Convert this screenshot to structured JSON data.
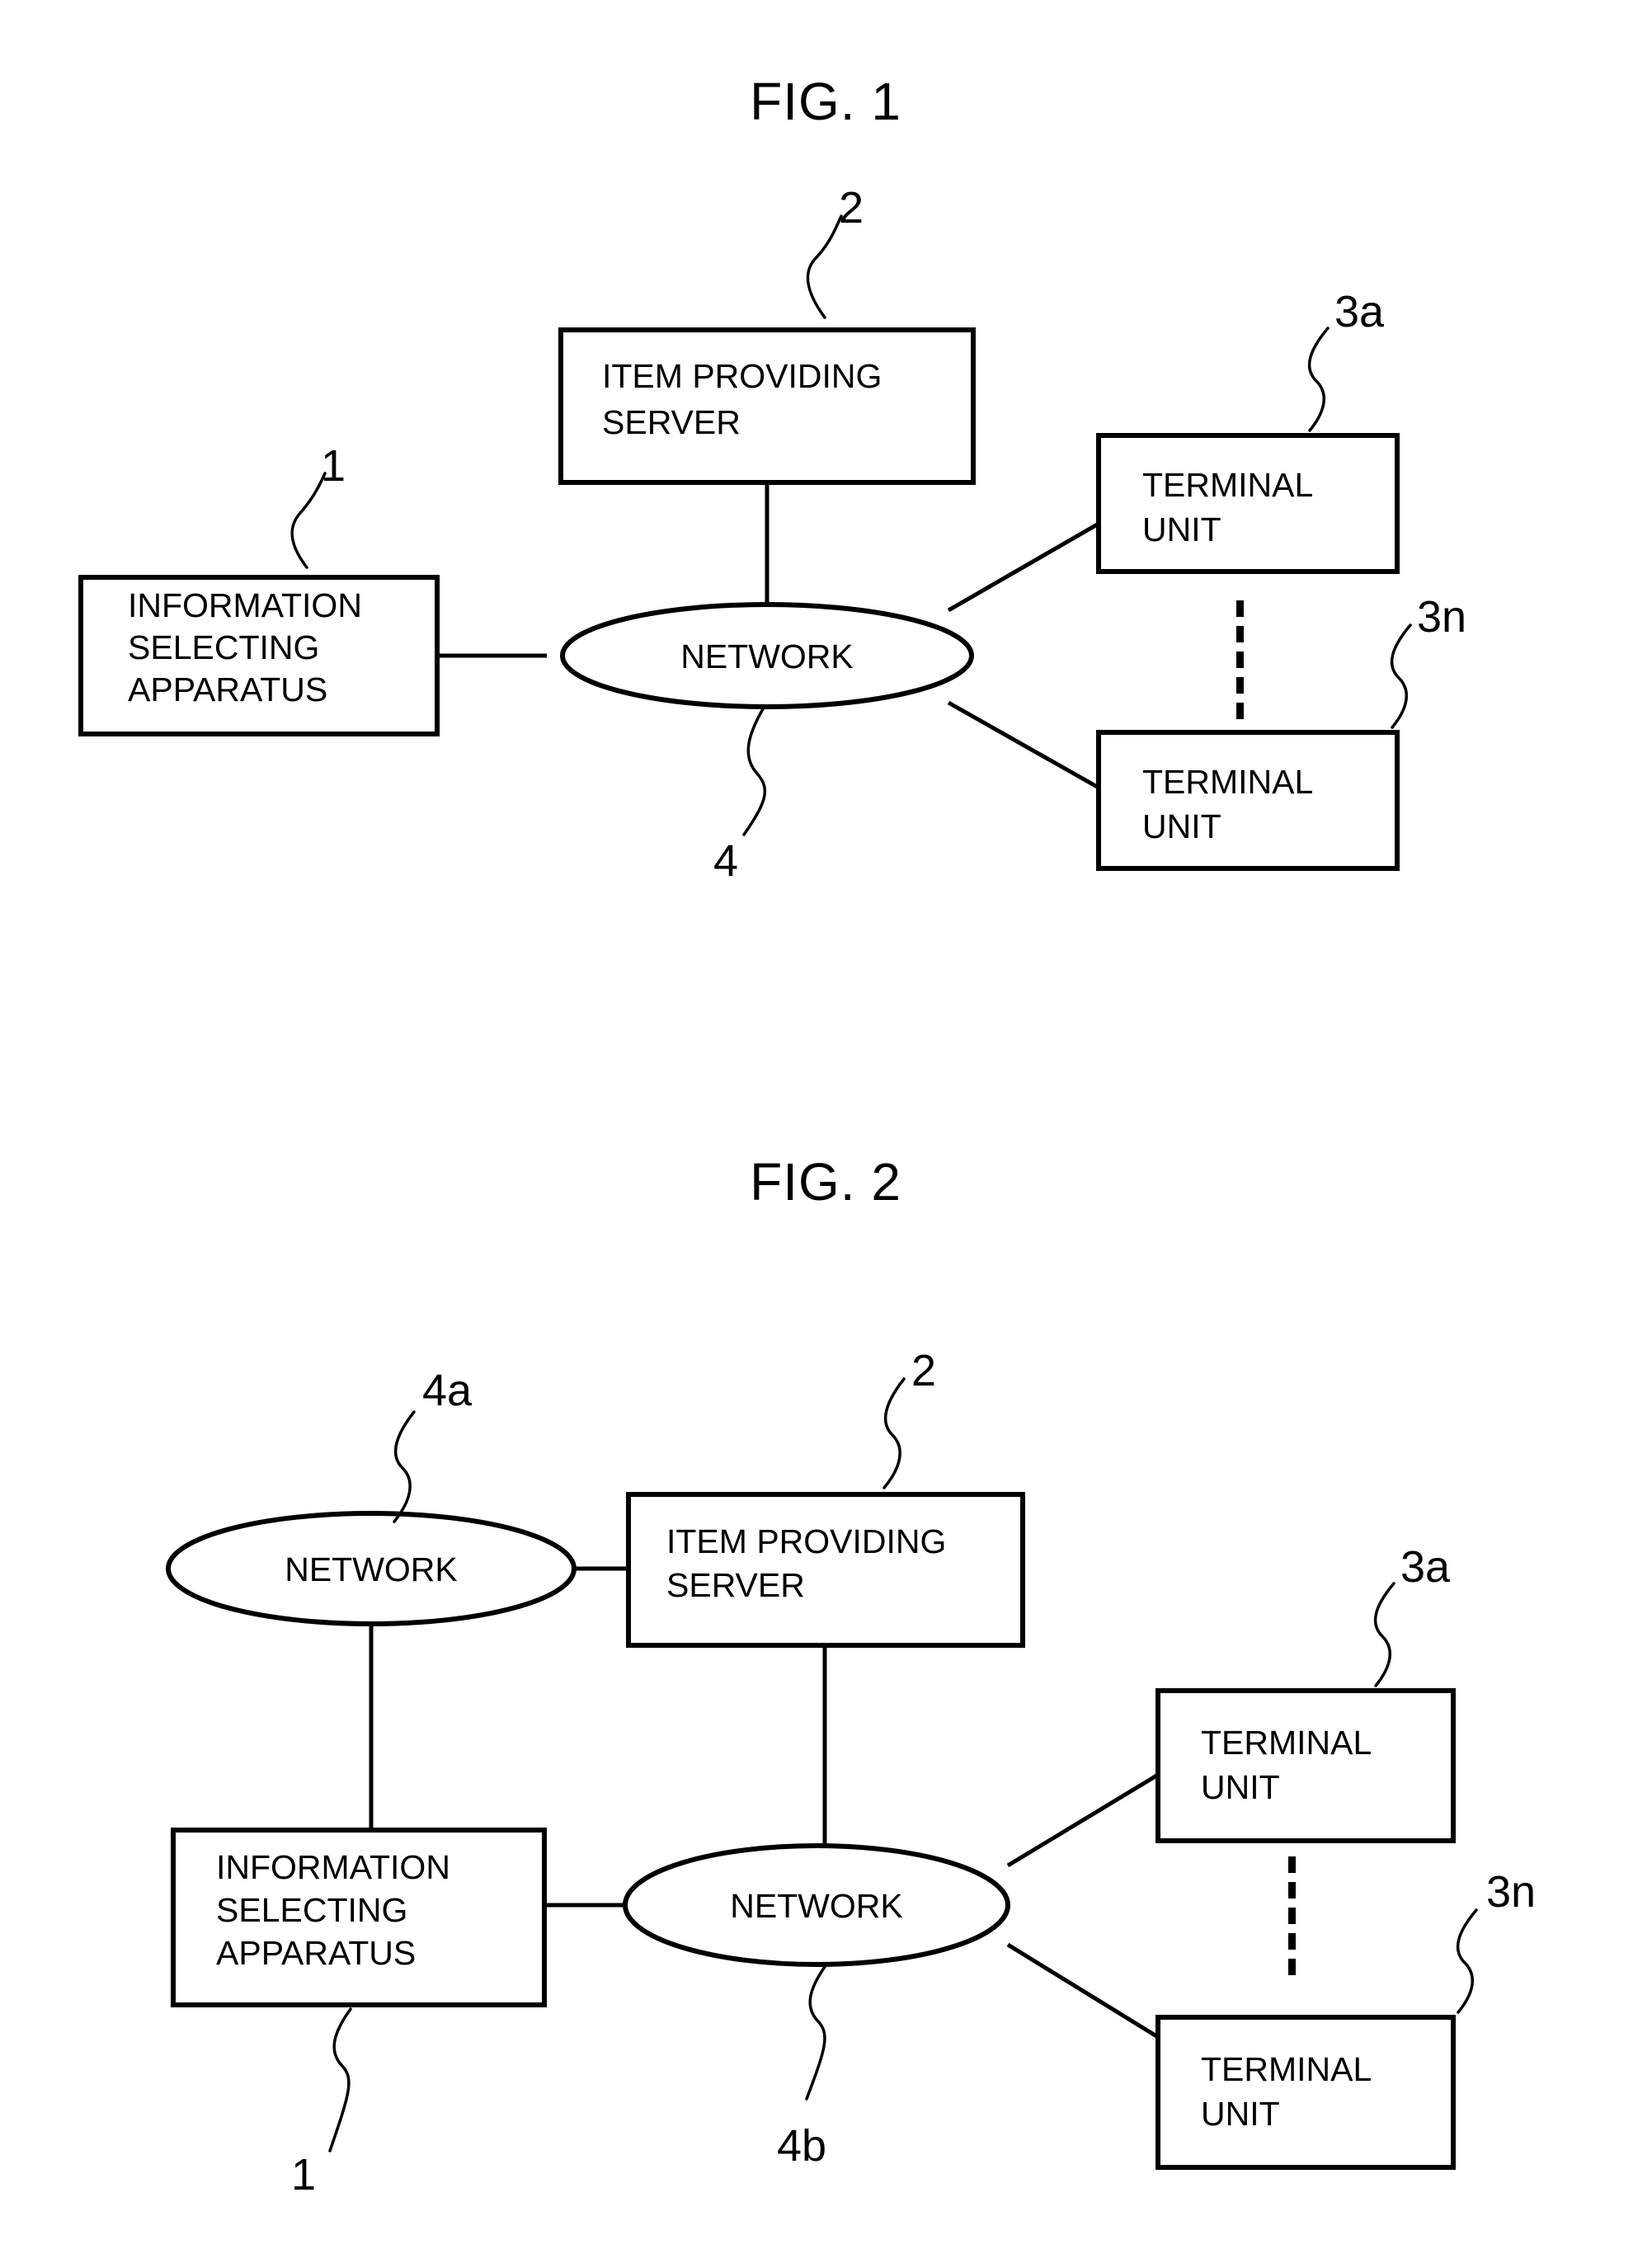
{
  "page": {
    "background": "#ffffff",
    "ink": "#000000"
  },
  "figures": [
    {
      "id": "fig1",
      "title": "FIG. 1",
      "nodes": [
        {
          "id": "f1-server",
          "shape": "box",
          "lines": [
            "ITEM PROVIDING",
            "SERVER"
          ],
          "ref": "2"
        },
        {
          "id": "f1-apparatus",
          "shape": "box",
          "lines": [
            "INFORMATION",
            "SELECTING",
            "APPARATUS"
          ],
          "ref": "1"
        },
        {
          "id": "f1-network",
          "shape": "ellipse",
          "lines": [
            "NETWORK"
          ],
          "ref": "4"
        },
        {
          "id": "f1-term-a",
          "shape": "box",
          "lines": [
            "TERMINAL",
            "UNIT"
          ],
          "ref": "3a"
        },
        {
          "id": "f1-term-n",
          "shape": "box",
          "lines": [
            "TERMINAL",
            "UNIT"
          ],
          "ref": "3n"
        }
      ],
      "ellipsis": "vertical-dots",
      "edges": [
        {
          "from": "f1-server",
          "to": "f1-network"
        },
        {
          "from": "f1-apparatus",
          "to": "f1-network"
        },
        {
          "from": "f1-network",
          "to": "f1-term-a"
        },
        {
          "from": "f1-network",
          "to": "f1-term-n"
        }
      ]
    },
    {
      "id": "fig2",
      "title": "FIG. 2",
      "nodes": [
        {
          "id": "f2-network-a",
          "shape": "ellipse",
          "lines": [
            "NETWORK"
          ],
          "ref": "4a"
        },
        {
          "id": "f2-server",
          "shape": "box",
          "lines": [
            "ITEM  PROVIDING",
            "SERVER"
          ],
          "ref": "2"
        },
        {
          "id": "f2-apparatus",
          "shape": "box",
          "lines": [
            "INFORMATION",
            "SELECTING",
            "APPARATUS"
          ],
          "ref": "1"
        },
        {
          "id": "f2-network-b",
          "shape": "ellipse",
          "lines": [
            "NETWORK"
          ],
          "ref": "4b"
        },
        {
          "id": "f2-term-a",
          "shape": "box",
          "lines": [
            "TERMINAL",
            "UNIT"
          ],
          "ref": "3a"
        },
        {
          "id": "f2-term-n",
          "shape": "box",
          "lines": [
            "TERMINAL",
            "UNIT"
          ],
          "ref": "3n"
        }
      ],
      "ellipsis": "vertical-dots",
      "edges": [
        {
          "from": "f2-network-a",
          "to": "f2-server"
        },
        {
          "from": "f2-network-a",
          "to": "f2-apparatus"
        },
        {
          "from": "f2-server",
          "to": "f2-network-b"
        },
        {
          "from": "f2-apparatus",
          "to": "f2-network-b"
        },
        {
          "from": "f2-network-b",
          "to": "f2-term-a"
        },
        {
          "from": "f2-network-b",
          "to": "f2-term-n"
        }
      ]
    }
  ],
  "fig1": {
    "title": "FIG. 1",
    "server": {
      "line1": "ITEM PROVIDING",
      "line2": "SERVER",
      "ref": "2"
    },
    "apparatus": {
      "line1": "INFORMATION",
      "line2": "SELECTING",
      "line3": "APPARATUS",
      "ref": "1"
    },
    "network": {
      "label": "NETWORK",
      "ref": "4"
    },
    "terminal_a": {
      "line1": "TERMINAL",
      "line2": "UNIT",
      "ref": "3a"
    },
    "terminal_n": {
      "line1": "TERMINAL",
      "line2": "UNIT",
      "ref": "3n"
    }
  },
  "fig2": {
    "title": "FIG. 2",
    "network_a": {
      "label": "NETWORK",
      "ref": "4a"
    },
    "server": {
      "line1": "ITEM  PROVIDING",
      "line2": "SERVER",
      "ref": "2"
    },
    "apparatus": {
      "line1": "INFORMATION",
      "line2": "SELECTING",
      "line3": "APPARATUS",
      "ref": "1"
    },
    "network_b": {
      "label": "NETWORK",
      "ref": "4b"
    },
    "terminal_a": {
      "line1": "TERMINAL",
      "line2": "UNIT",
      "ref": "3a"
    },
    "terminal_n": {
      "line1": "TERMINAL",
      "line2": "UNIT",
      "ref": "3n"
    }
  }
}
